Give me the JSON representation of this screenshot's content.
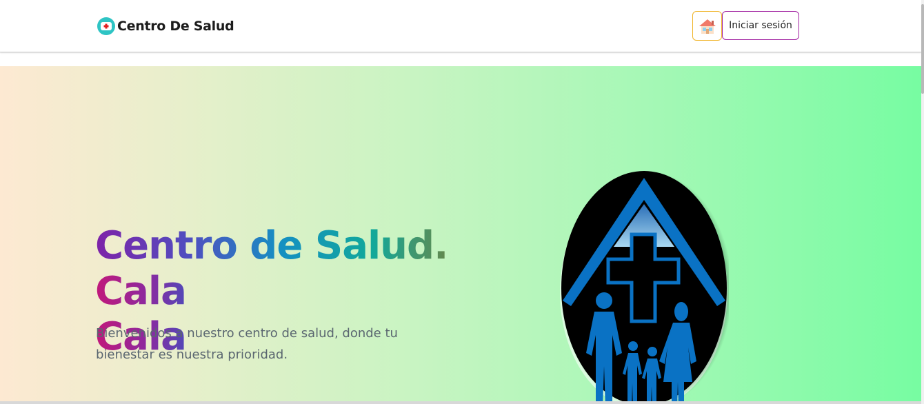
{
  "navbar": {
    "brand_name": "Centro De Salud",
    "brand_icon": "medical-cross-badge-icon",
    "home_icon": "house-icon",
    "login_label": "Iniciar sesión"
  },
  "hero": {
    "title_line1": "Centro de Salud.",
    "title_line2": "Cala Cala",
    "subtitle": "Bienvenidos a nuestro centro de salud, donde tu bienestar es nuestra prioridad.",
    "logo_icon": "family-health-center-logo"
  },
  "colors": {
    "accent_home_border": "#f0b429",
    "accent_login_border": "#a020a0",
    "logo_blue": "#0a72c4",
    "gradient_start": "#fde9d2",
    "gradient_end": "#77fca2"
  }
}
